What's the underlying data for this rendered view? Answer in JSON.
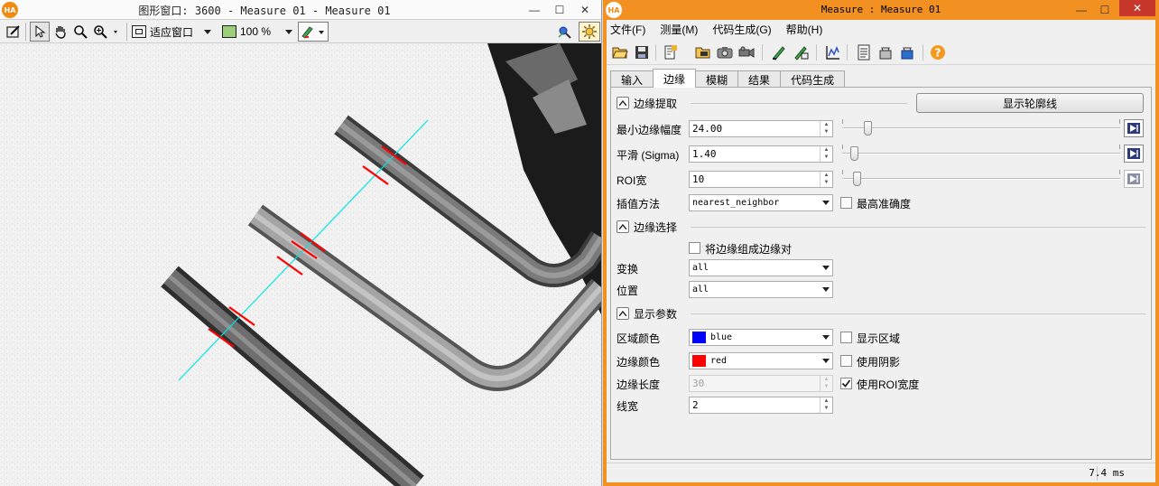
{
  "graphics_window": {
    "title": "图形窗口: 3600 - Measure 01 - Measure 01",
    "toolbar": {
      "zoom_fit_label": "适应窗口",
      "zoom_percent": "100 %"
    },
    "icons": [
      "edit-icon",
      "pointer-icon",
      "hand-icon",
      "magnifier-icon",
      "zoom-icon",
      "fit-window-icon",
      "zoom-percent-icon",
      "pen-icon",
      "pixel-info-icon",
      "settings-icon"
    ]
  },
  "measure_window": {
    "title": "Measure : Measure 01",
    "menu": [
      "文件(F)",
      "测量(M)",
      "代码生成(G)",
      "帮助(H)"
    ],
    "tabs": [
      "输入",
      "边缘",
      "模糊",
      "结果",
      "代码生成"
    ],
    "active_tab": "边缘",
    "edge_extraction": {
      "header": "边缘提取",
      "show_contour_button": "显示轮廓线",
      "min_amplitude_label": "最小边缘幅度",
      "min_amplitude_value": "24.00",
      "min_amplitude_slider_fraction": 0.08,
      "sigma_label": "平滑 (Sigma)",
      "sigma_value": "1.40",
      "sigma_slider_fraction": 0.03,
      "roi_width_label": "ROI宽",
      "roi_width_value": "10",
      "roi_width_slider_fraction": 0.04,
      "interp_label": "插值方法",
      "interp_value": "nearest_neighbor",
      "max_precision_label": "最高准确度",
      "max_precision_checked": false
    },
    "edge_selection": {
      "header": "边缘选择",
      "pair_label": "将边缘组成边缘对",
      "pair_checked": false,
      "transition_label": "变换",
      "transition_value": "all",
      "position_label": "位置",
      "position_value": "all"
    },
    "display_params": {
      "header": "显示参数",
      "region_color_label": "区域颜色",
      "region_color_value": "blue",
      "region_color": "#0000ff",
      "show_region_label": "显示区域",
      "show_region_checked": false,
      "edge_color_label": "边缘颜色",
      "edge_color_value": "red",
      "edge_color": "#ff0000",
      "use_shadow_label": "使用阴影",
      "use_shadow_checked": false,
      "edge_length_label": "边缘长度",
      "edge_length_value": "30",
      "use_roi_width_label": "使用ROI宽度",
      "use_roi_width_checked": true,
      "line_width_label": "线宽",
      "line_width_value": "2"
    },
    "status": {
      "time": "7.4 ms"
    }
  },
  "colors": {
    "halcon_orange": "#f29121",
    "measure_line": "#00e5e5",
    "edge_marks": "#ff0000"
  }
}
